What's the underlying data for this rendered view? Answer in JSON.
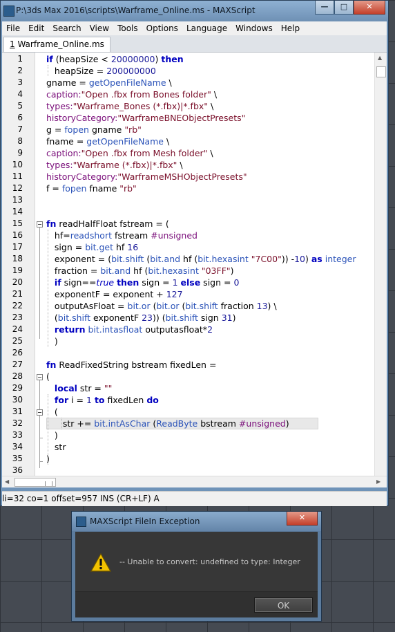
{
  "window": {
    "title": "P:\\3ds Max 2016\\scripts\\Warframe_Online.ms - MAXScript",
    "min": "—",
    "max": "□",
    "close": "✕"
  },
  "menu": [
    "File",
    "Edit",
    "Search",
    "View",
    "Tools",
    "Options",
    "Language",
    "Windows",
    "Help"
  ],
  "tab": {
    "index": "1",
    "name": " Warframe_Online.ms"
  },
  "editor": {
    "line_numbers": [
      "1",
      "2",
      "3",
      "4",
      "5",
      "6",
      "7",
      "8",
      "9",
      "10",
      "11",
      "12",
      "13",
      "14",
      "15",
      "16",
      "17",
      "18",
      "19",
      "20",
      "21",
      "22",
      "23",
      "24",
      "25",
      "26",
      "27",
      "28",
      "29",
      "30",
      "31",
      "32",
      "33",
      "34",
      "35",
      "36"
    ],
    "current_line": 32
  },
  "status": "li=32 co=1 offset=957 INS (CR+LF) A",
  "dialog": {
    "title": "MAXScript FileIn Exception",
    "message": "-- Unable to convert: undefined to type: Integer",
    "ok": "OK",
    "close": "✕"
  }
}
